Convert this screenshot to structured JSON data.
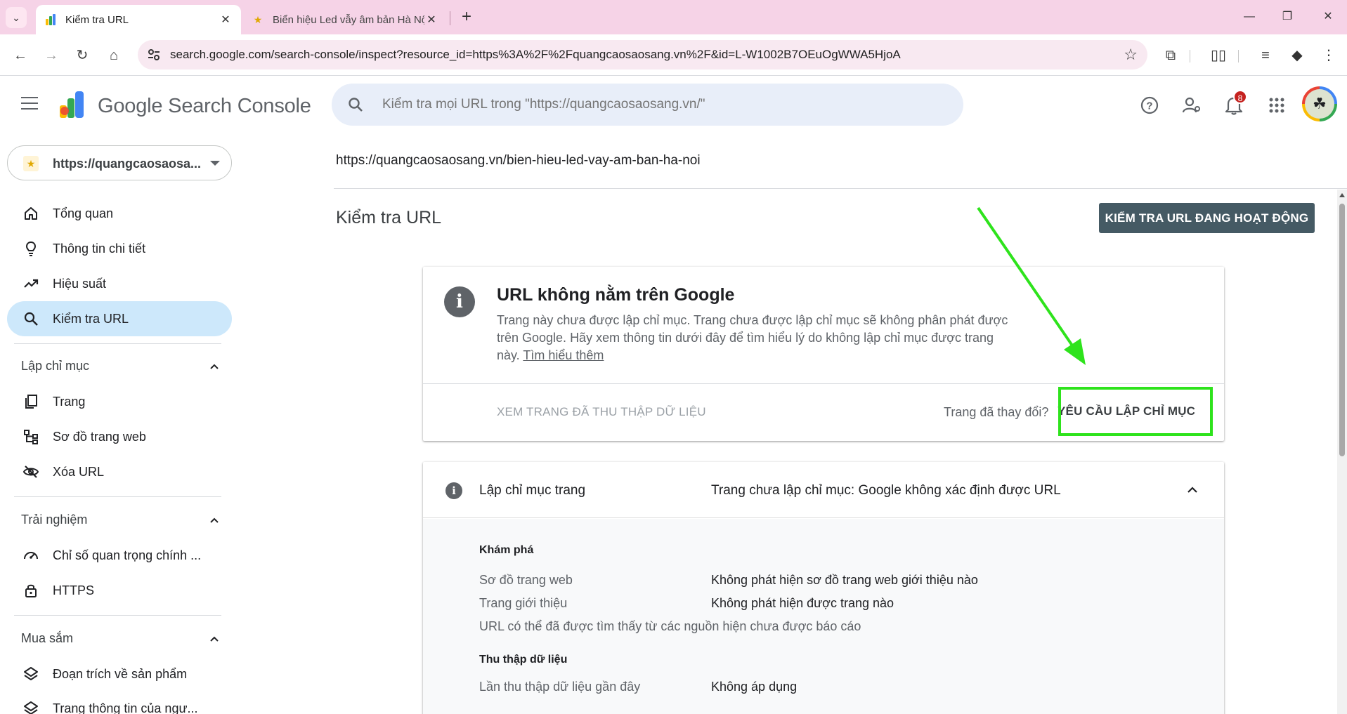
{
  "browser": {
    "tabs": [
      {
        "title": "Kiểm tra URL",
        "active": true
      },
      {
        "title": "Biển hiệu Led vẫy âm bản Hà Nội",
        "active": false
      }
    ],
    "new_tab": "+",
    "url": "search.google.com/search-console/inspect?resource_id=https%3A%2F%2Fquangcaosaosang.vn%2F&id=L-W1002B7OEuOgWWA5HjoA"
  },
  "header": {
    "app_name": "Google Search Console",
    "search_placeholder": "Kiểm tra mọi URL trong \"https://quangcaosaosang.vn/\"",
    "notification_count": "8"
  },
  "sidebar": {
    "property": "https://quangcaosaosa...",
    "items": [
      {
        "label": "Tổng quan",
        "icon": "home-icon"
      },
      {
        "label": "Thông tin chi tiết",
        "icon": "lightbulb-icon"
      },
      {
        "label": "Hiệu suất",
        "icon": "trending-up-icon"
      },
      {
        "label": "Kiểm tra URL",
        "icon": "search-icon",
        "active": true
      }
    ],
    "sections": [
      {
        "title": "Lập chỉ mục",
        "items": [
          {
            "label": "Trang",
            "icon": "pages-icon"
          },
          {
            "label": "Sơ đồ trang web",
            "icon": "sitemap-icon"
          },
          {
            "label": "Xóa URL",
            "icon": "eye-off-icon"
          }
        ]
      },
      {
        "title": "Trải nghiệm",
        "items": [
          {
            "label": "Chỉ số quan trọng chính ...",
            "icon": "speedometer-icon"
          },
          {
            "label": "HTTPS",
            "icon": "lock-icon"
          }
        ]
      },
      {
        "title": "Mua sắm",
        "items": [
          {
            "label": "Đoạn trích về sản phẩm",
            "icon": "layers-icon"
          },
          {
            "label": "Trang thông tin của ngư...",
            "icon": "layers-icon"
          }
        ]
      }
    ]
  },
  "main": {
    "inspected_url": "https://quangcaosaosang.vn/bien-hieu-led-vay-am-ban-ha-noi",
    "page_title": "Kiểm tra URL",
    "live_test_button": "KIỂM TRA URL ĐANG HOẠT ĐỘNG",
    "status_card": {
      "title": "URL không nằm trên Google",
      "description": "Trang này chưa được lập chỉ mục. Trang chưa được lập chỉ mục sẽ không phân phát được trên Google. Hãy xem thông tin dưới đây để tìm hiểu lý do không lập chỉ mục được trang này.",
      "learn_more": "Tìm hiểu thêm",
      "view_crawled": "XEM TRANG ĐÃ THU THẬP DỮ LIỆU",
      "changed_question": "Trang đã thay đổi?",
      "request_indexing": "YÊU CẦU LẬP CHỈ MỤC"
    },
    "indexing_card": {
      "label": "Lập chỉ mục trang",
      "status": "Trang chưa lập chỉ mục: Google không xác định được URL",
      "discovery_title": "Khám phá",
      "rows": [
        {
          "label": "Sơ đồ trang web",
          "value": "Không phát hiện sơ đồ trang web giới thiệu nào"
        },
        {
          "label": "Trang giới thiệu",
          "value": "Không phát hiện được trang nào"
        }
      ],
      "note": "URL có thể đã được tìm thấy từ các nguồn hiện chưa được báo cáo",
      "crawl_title": "Thu thập dữ liệu",
      "crawl_rows": [
        {
          "label": "Lần thu thập dữ liệu gần đây",
          "value": "Không áp dụng"
        }
      ]
    }
  },
  "colors": {
    "tabbar_bg": "#f6d3e7",
    "active_nav_bg": "#cde8fb",
    "live_button_bg": "#455a64",
    "annotation_green": "#2ee31c",
    "badge_red": "#c5221f"
  }
}
